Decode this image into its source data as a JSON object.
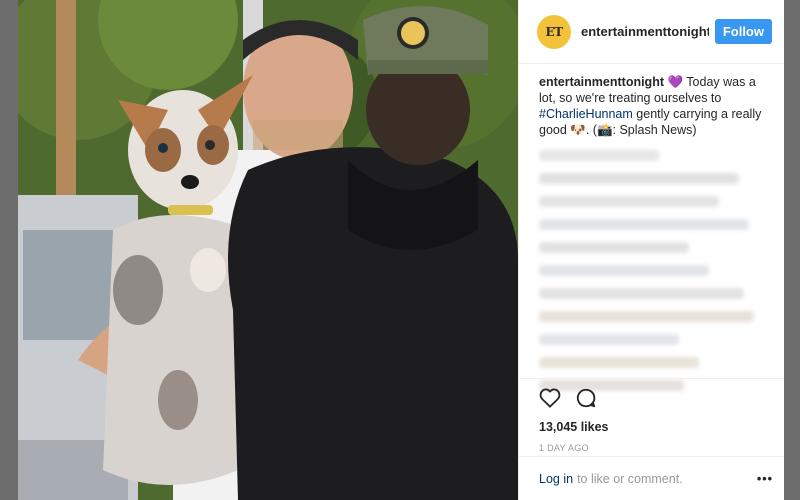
{
  "post": {
    "account_avatar_text": "ET",
    "account": "entertainmenttonight",
    "follow_label": "Follow",
    "caption_user": "entertainmenttonight",
    "caption_emoji": "💜",
    "caption_text_1": " Today was a lot, so we're treating ourselves to ",
    "caption_hashtag": "#CharlieHunnam",
    "caption_text_2": " gently carrying a really good 🐶. (📸: Splash News)",
    "likes": "13,045 likes",
    "time_ago": "1 DAY AGO",
    "login_link": "Log in",
    "login_text": "to like or comment.",
    "more_label": "•••"
  },
  "icons": {
    "like": "heart-icon",
    "comment": "comment-icon",
    "more": "more-options-icon"
  },
  "colors": {
    "follow_button": "#3897f0",
    "link": "#003569",
    "avatar_bg": "#f4c13a"
  }
}
